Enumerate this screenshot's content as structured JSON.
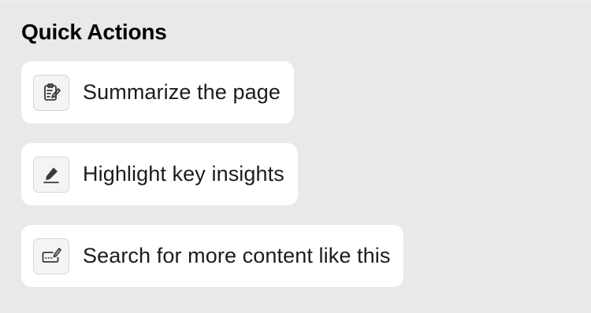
{
  "quick_actions": {
    "title": "Quick Actions",
    "items": [
      {
        "label": "Summarize the page",
        "icon": "clipboard-edit-icon"
      },
      {
        "label": "Highlight key insights",
        "icon": "highlighter-pen-icon"
      },
      {
        "label": "Search for more content like this",
        "icon": "input-edit-icon"
      }
    ]
  },
  "colors": {
    "background": "#e9e9eb",
    "card": "#ffffff",
    "icon_border": "#d4d4d8",
    "text": "#1c1c1e"
  }
}
